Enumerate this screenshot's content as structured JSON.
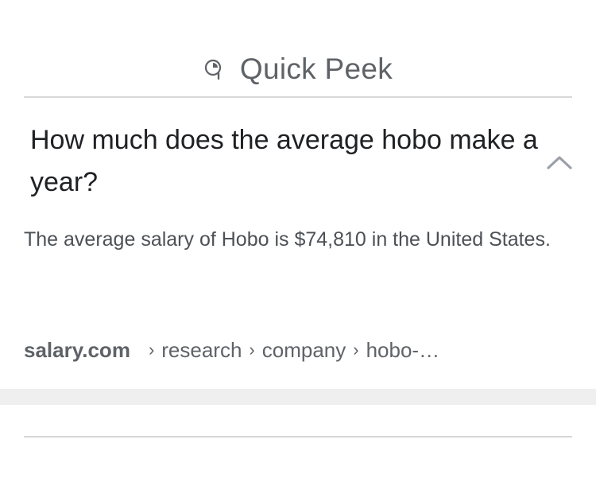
{
  "header": {
    "icon": "quick-peek-icon",
    "title": "Quick Peek"
  },
  "question": {
    "text": "How much does the average hobo make a year?",
    "expanded": true,
    "toggle_icon": "chevron-up-icon"
  },
  "answer": {
    "text": "The average salary of Hobo is $74,810 in the United States."
  },
  "source": {
    "domain": "salary.com",
    "separator": "›",
    "path": [
      "research",
      "company",
      "hobo-…"
    ]
  },
  "colors": {
    "header_text": "#5f6368",
    "question_text": "#202124",
    "answer_text": "#4d5156",
    "divider": "#d7d7d7",
    "band": "#efefef"
  }
}
